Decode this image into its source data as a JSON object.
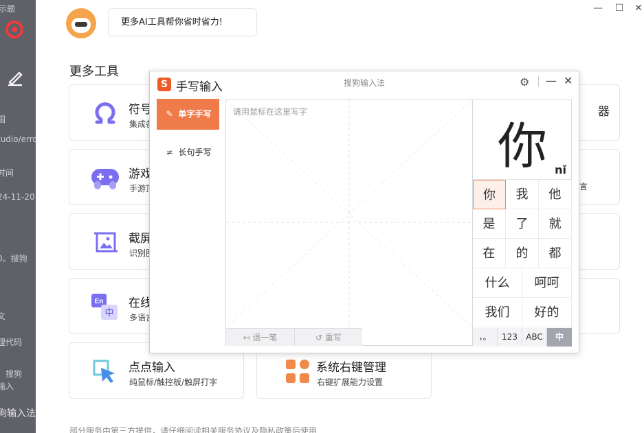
{
  "background_app": {
    "left_fragments": [
      "示题",
      "tudio/erro",
      "时间",
      "24-11-20",
      "0。搜狗",
      "文",
      "理代码",
      "。搜狗",
      "输入",
      "狗输入法"
    ],
    "avatar_bubble": "更多AI工具帮你省时省力!",
    "section_title": "更多工具",
    "cards_left": [
      {
        "title": "符号",
        "subtitle": "集成各",
        "icon": "omega-icon"
      },
      {
        "title": "游戏",
        "subtitle": "手游顶",
        "icon": "gamepad-icon"
      },
      {
        "title": "截屏",
        "subtitle": "识别图",
        "icon": "screenshot-icon"
      },
      {
        "title": "在线",
        "subtitle": "多语言",
        "icon": "translate-icon"
      },
      {
        "title": "点点输入",
        "subtitle": "纯鼠标/触控板/触屏打字",
        "icon": "click-input-icon"
      }
    ],
    "cards_right": [
      {
        "fragment": "器"
      },
      {
        "fragment": "言"
      },
      {
        "fragment": ""
      },
      {
        "fragment": ""
      },
      {
        "title": "系统右键管理",
        "subtitle": "右键扩展能力设置",
        "icon": "context-menu-icon"
      }
    ],
    "footer_note": "部分服务由第三方提供，请仔细阅读相关服务协议及隐私政策后使用",
    "window_controls": {
      "minimize": "—",
      "maximize": "☐",
      "close": "✕"
    }
  },
  "handwriting": {
    "logo": "S",
    "title": "手写输入",
    "brand": "搜狗输入法",
    "controls": {
      "settings": "⚙",
      "minimize": "—",
      "close": "✕"
    },
    "modes": [
      {
        "label": "单字手写",
        "icon": "✎",
        "active": true
      },
      {
        "label": "长句手写",
        "icon": "≠",
        "active": false
      }
    ],
    "pad_hint": "请用鼠标在这里写字",
    "pad_buttons": {
      "undo": "退一笔",
      "rewrite": "重写"
    },
    "preview_char": "你",
    "preview_pinyin": "nǐ",
    "candidates_rows": [
      [
        "你",
        "我",
        "他"
      ],
      [
        "是",
        "了",
        "就"
      ],
      [
        "在",
        "的",
        "都"
      ],
      [
        "什么",
        "呵呵"
      ],
      [
        "我们",
        "好的"
      ]
    ],
    "keyboard_modes": [
      "，。",
      "123",
      "ABC",
      "中"
    ],
    "active_keyboard": "中",
    "accent_color": "#ef7a4a"
  }
}
